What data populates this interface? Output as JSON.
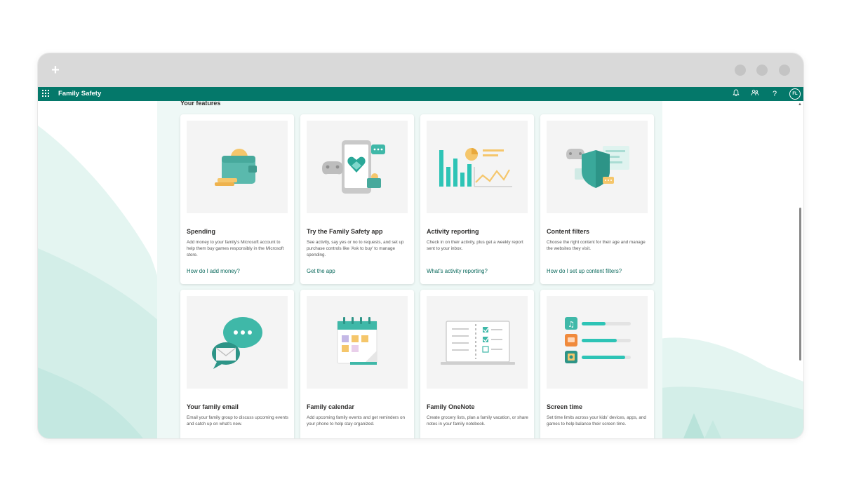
{
  "window": {
    "new_tab_glyph": "+",
    "controls": [
      "window-control-1",
      "window-control-2",
      "window-control-3"
    ]
  },
  "appbar": {
    "title": "Family Safety",
    "icons": [
      "bell-icon",
      "family-icon",
      "help-icon"
    ],
    "help_glyph": "?",
    "avatar_initials": "FL",
    "color": "#04786a"
  },
  "main": {
    "section_title": "Your features",
    "cards": [
      {
        "title": "Spending",
        "description": "Add money to your family's Microsoft account to help them buy games responsibly in the Microsoft store.",
        "link": "How do I add money?"
      },
      {
        "title": "Try the Family Safety app",
        "description": "See activity, say yes or no to requests, and set up purchase controls like 'Ask to buy' to manage spending.",
        "link": "Get the app"
      },
      {
        "title": "Activity reporting",
        "description": "Check in on their activity, plus get a weekly report sent to your inbox.",
        "link": "What's activity reporting?"
      },
      {
        "title": "Content filters",
        "description": "Choose the right content for their age and manage the websites they visit.",
        "link": "How do I set up content filters?"
      },
      {
        "title": "Your family email",
        "description": "Email your family group to discuss upcoming events and catch up on what's new.",
        "link": ""
      },
      {
        "title": "Family calendar",
        "description": "Add upcoming family events and get reminders on your phone to help stay organized.",
        "link": ""
      },
      {
        "title": "Family OneNote",
        "description": "Create grocery lists, plan a family vacation, or share notes in your family notebook.",
        "link": ""
      },
      {
        "title": "Screen time",
        "description": "Set time limits across your kids' devices, apps, and games to help balance their screen time.",
        "link": ""
      }
    ]
  },
  "colors": {
    "accent": "#04786a",
    "teal": "#2ec4b6",
    "link": "#0b6a5d",
    "background_hill": "#e3f4f1"
  }
}
